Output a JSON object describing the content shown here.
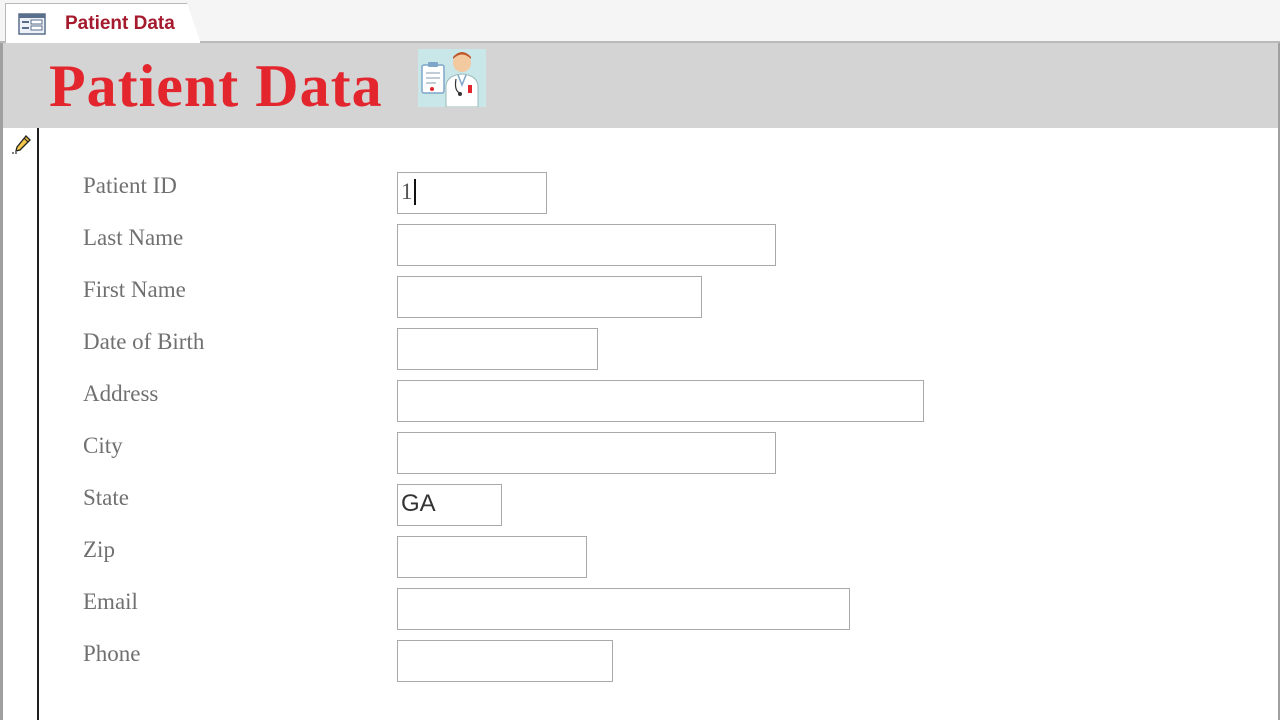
{
  "tab": {
    "title": "Patient Data",
    "icon": "form-icon"
  },
  "header": {
    "title": "Patient Data",
    "image": "doctor-illustration"
  },
  "record_selector": {
    "icon": "pencil-icon",
    "state": "editing"
  },
  "fields": [
    {
      "label": "Patient ID",
      "value": "1"
    },
    {
      "label": "Last Name",
      "value": ""
    },
    {
      "label": "First Name",
      "value": ""
    },
    {
      "label": "Date of Birth",
      "value": ""
    },
    {
      "label": "Address",
      "value": ""
    },
    {
      "label": "City",
      "value": ""
    },
    {
      "label": "State",
      "value": "GA"
    },
    {
      "label": "Zip",
      "value": ""
    },
    {
      "label": "Email",
      "value": ""
    },
    {
      "label": "Phone",
      "value": ""
    }
  ],
  "colors": {
    "title_red": "#e3262d",
    "tab_label": "#a51a2d",
    "header_band": "#d4d4d4",
    "label_gray": "#707070"
  }
}
